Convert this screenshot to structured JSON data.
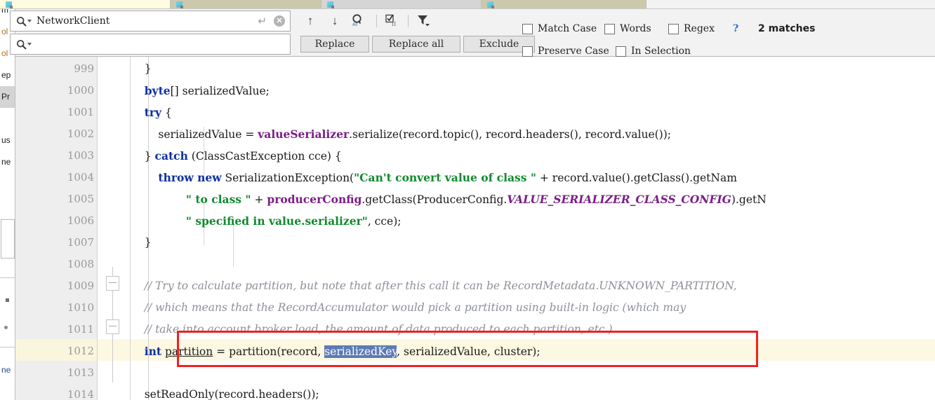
{
  "tabs": [
    {
      "label": ""
    },
    {
      "label": ""
    },
    {
      "label": ""
    },
    {
      "label": ""
    }
  ],
  "left_panel": {
    "rows": [
      "m",
      "ol",
      "ol",
      "ep",
      "Pr",
      "us",
      "ne",
      "ne"
    ]
  },
  "find": {
    "search": {
      "value": "NetworkClient",
      "placeholder": ""
    },
    "replace": {
      "value": "",
      "placeholder": ""
    },
    "buttons": {
      "replace": "Replace",
      "replace_all": "Replace all",
      "exclude": "Exclude"
    },
    "options": [
      {
        "label": "Match Case",
        "checked": false
      },
      {
        "label": "Words",
        "checked": false
      },
      {
        "label": "Regex",
        "checked": false
      },
      {
        "label": "Preserve Case",
        "checked": false
      },
      {
        "label": "In Selection",
        "checked": false
      }
    ],
    "help_label": "?",
    "match_count": "2 matches"
  },
  "editor": {
    "language": "java",
    "selected_text": "serializedKey",
    "current_line": "1012",
    "colors": {
      "keyword": "#0d2fa0",
      "field": "#7a1f86",
      "string": "#118a2e",
      "comment": "#8c9099",
      "selection": "#5c7bb5",
      "caret_line": "#fdf8e2",
      "annotation": "#ef2222"
    },
    "lines": [
      {
        "num": "999",
        "text": "    }"
      },
      {
        "num": "1000",
        "text": "    byte[] serializedValue;"
      },
      {
        "num": "1001",
        "text": "    try {"
      },
      {
        "num": "1002",
        "text": "        serializedValue = valueSerializer.serialize(record.topic(), record.headers(), record.value());"
      },
      {
        "num": "1003",
        "text": "    } catch (ClassCastException cce) {"
      },
      {
        "num": "1004",
        "text": "        throw new SerializationException(\"Can't convert value of class \" + record.value().getClass().getNam"
      },
      {
        "num": "1005",
        "text": "                \" to class \" + producerConfig.getClass(ProducerConfig.VALUE_SERIALIZER_CLASS_CONFIG).getN"
      },
      {
        "num": "1006",
        "text": "                \" specified in value.serializer\", cce);"
      },
      {
        "num": "1007",
        "text": "    }"
      },
      {
        "num": "1008",
        "text": ""
      },
      {
        "num": "1009",
        "text": "    // Try to calculate partition, but note that after this call it can be RecordMetadata.UNKNOWN_PARTITION,"
      },
      {
        "num": "1010",
        "text": "    // which means that the RecordAccumulator would pick a partition using built-in logic (which may"
      },
      {
        "num": "1011",
        "text": "    // take into account broker load, the amount of data produced to each partition, etc.)."
      },
      {
        "num": "1012",
        "text": "    int partition = partition(record, serializedKey, serializedValue, cluster);"
      },
      {
        "num": "1013",
        "text": ""
      },
      {
        "num": "1014",
        "text": "    setReadOnly(record.headers());"
      }
    ]
  }
}
